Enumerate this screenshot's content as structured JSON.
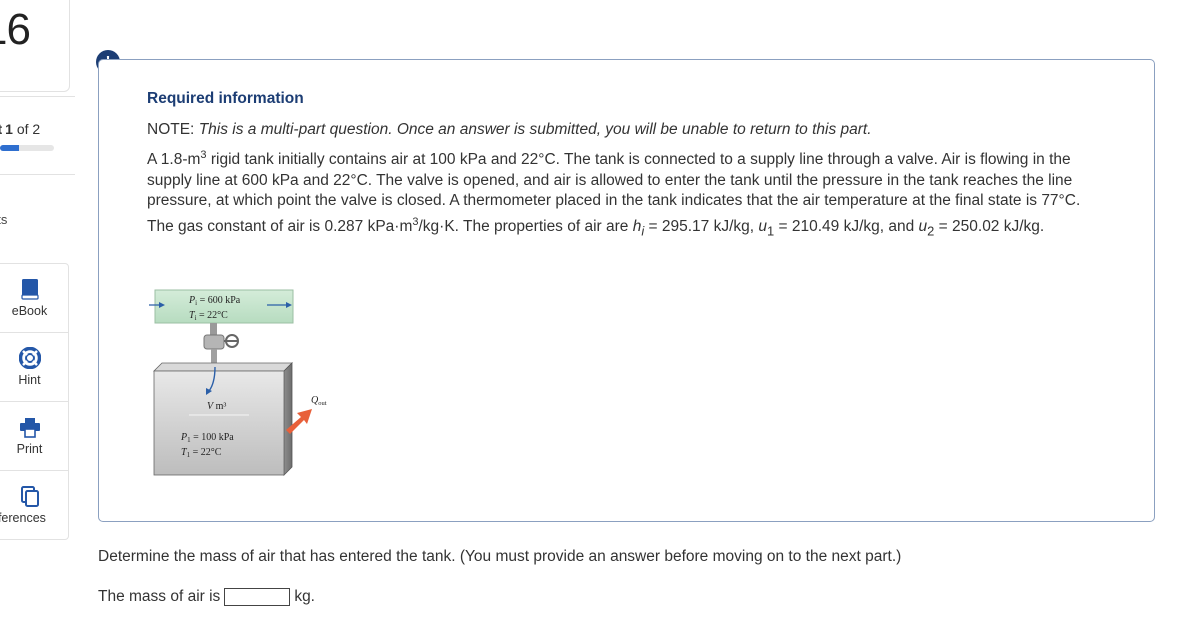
{
  "sidebar": {
    "question_number": "16",
    "part_label_prefix": "rt",
    "part_current": "1",
    "part_of_total": "of 2",
    "progress_fraction": 0.35,
    "points_label": "nts",
    "tools": [
      {
        "label": "eBook",
        "icon": "book-icon"
      },
      {
        "label": "Hint",
        "icon": "lifebuoy-icon"
      },
      {
        "label": "Print",
        "icon": "printer-icon"
      },
      {
        "label": "eferences",
        "icon": "copy-icon"
      }
    ]
  },
  "panel": {
    "alert_symbol": "!",
    "heading": "Required information",
    "note_prefix": "NOTE:",
    "note_text": "This is a multi-part question. Once an answer is submitted, you will be unable to return to this part.",
    "p1": "A 1.8-m",
    "p1_sup": "3",
    "p2": " rigid tank initially contains air at 100 kPa and 22°C. The tank is connected to a supply line through a valve. Air is flowing in the supply line at 600 kPa and 22°C. The valve is opened, and air is allowed to enter the tank until the pressure in the tank reaches the line pressure, at which point the valve is closed. A thermometer placed in the tank indicates that the air temperature at the final state is 77°C. The gas constant of air is 0.287 kPa·m",
    "p2_sup": "3",
    "p3": "/kg·K. The properties of air are ",
    "hi": "h",
    "hi_sub": "i",
    "p4": " = 295.17 kJ/kg, ",
    "u1": "u",
    "u1_sub": "1",
    "p5": " = 210.49 kJ/kg, and ",
    "u2": "u",
    "u2_sub": "2",
    "p6": " = 250.02 kJ/kg.",
    "figure": {
      "line_p": "P",
      "line_p_sub": "i",
      "line_p_val": " = 600 kPa",
      "line_t": "T",
      "line_t_sub": "i",
      "line_t_val": " = 22°C",
      "volume_v": "V",
      "volume_unit": " m³",
      "tank_p": "P",
      "tank_p_sub": "1",
      "tank_p_val": " = 100 kPa",
      "tank_t": "T",
      "tank_t_sub": "1",
      "tank_t_val": " = 22°C",
      "q": "Q",
      "q_sub": "out"
    }
  },
  "question": {
    "prompt": "Determine the mass of air that has entered the tank. (You must provide an answer before moving on to the next part.)",
    "answer_prefix": "The mass of air is",
    "answer_value": "",
    "answer_unit": "kg."
  }
}
